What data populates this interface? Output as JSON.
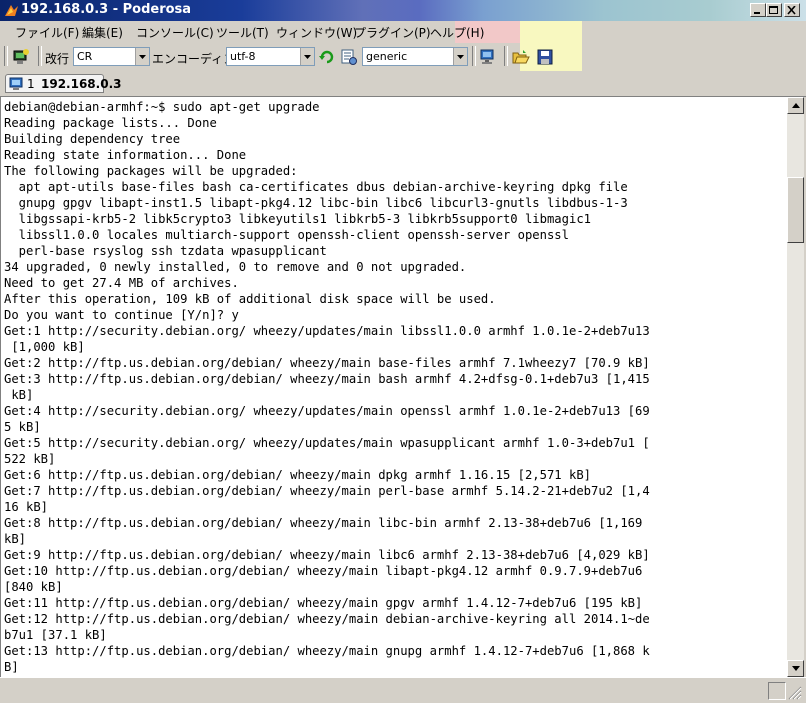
{
  "window": {
    "title": "192.168.0.3 - Poderosa",
    "colors": {
      "titlebar_start": "#0a246a",
      "chrome": "#d4d0c8"
    }
  },
  "menubar": {
    "items": [
      {
        "label": "ファイル(F)"
      },
      {
        "label": "編集(E)"
      },
      {
        "label": "コンソール(C)"
      },
      {
        "label": "ツール(T)"
      },
      {
        "label": "ウィンドウ(W)"
      },
      {
        "label": "プラグイン(P)"
      },
      {
        "label": "ヘルプ(H)"
      }
    ]
  },
  "toolbar": {
    "newline_label": "改行",
    "newline_value": "CR",
    "encoding_label": "エンコーディング",
    "encoding_value": "utf-8",
    "terminal_type_value": "generic",
    "icons": [
      "new-connection-icon",
      "reload-icon",
      "terminal-settings-icon",
      "network-icon",
      "open-folder-icon",
      "save-icon"
    ]
  },
  "tabs": [
    {
      "number": "1",
      "label": "192.168.0.3"
    }
  ],
  "terminal": {
    "lines": [
      "debian@debian-armhf:~$ sudo apt-get upgrade",
      "Reading package lists... Done",
      "Building dependency tree",
      "Reading state information... Done",
      "The following packages will be upgraded:",
      "  apt apt-utils base-files bash ca-certificates dbus debian-archive-keyring dpkg file",
      "  gnupg gpgv libapt-inst1.5 libapt-pkg4.12 libc-bin libc6 libcurl3-gnutls libdbus-1-3",
      "  libgssapi-krb5-2 libk5crypto3 libkeyutils1 libkrb5-3 libkrb5support0 libmagic1",
      "  libssl1.0.0 locales multiarch-support openssh-client openssh-server openssl",
      "  perl-base rsyslog ssh tzdata wpasupplicant",
      "34 upgraded, 0 newly installed, 0 to remove and 0 not upgraded.",
      "Need to get 27.4 MB of archives.",
      "After this operation, 109 kB of additional disk space will be used.",
      "Do you want to continue [Y/n]? y",
      "Get:1 http://security.debian.org/ wheezy/updates/main libssl1.0.0 armhf 1.0.1e-2+deb7u13",
      " [1,000 kB]",
      "Get:2 http://ftp.us.debian.org/debian/ wheezy/main base-files armhf 7.1wheezy7 [70.9 kB]",
      "Get:3 http://ftp.us.debian.org/debian/ wheezy/main bash armhf 4.2+dfsg-0.1+deb7u3 [1,415",
      " kB]",
      "Get:4 http://security.debian.org/ wheezy/updates/main openssl armhf 1.0.1e-2+deb7u13 [69",
      "5 kB]",
      "Get:5 http://security.debian.org/ wheezy/updates/main wpasupplicant armhf 1.0-3+deb7u1 [",
      "522 kB]",
      "Get:6 http://ftp.us.debian.org/debian/ wheezy/main dpkg armhf 1.16.15 [2,571 kB]",
      "Get:7 http://ftp.us.debian.org/debian/ wheezy/main perl-base armhf 5.14.2-21+deb7u2 [1,4",
      "16 kB]",
      "Get:8 http://ftp.us.debian.org/debian/ wheezy/main libc-bin armhf 2.13-38+deb7u6 [1,169",
      "kB]",
      "Get:9 http://ftp.us.debian.org/debian/ wheezy/main libc6 armhf 2.13-38+deb7u6 [4,029 kB]",
      "Get:10 http://ftp.us.debian.org/debian/ wheezy/main libapt-pkg4.12 armhf 0.9.7.9+deb7u6",
      "[840 kB]",
      "Get:11 http://ftp.us.debian.org/debian/ wheezy/main gpgv armhf 1.4.12-7+deb7u6 [195 kB]",
      "Get:12 http://ftp.us.debian.org/debian/ wheezy/main debian-archive-keyring all 2014.1~de",
      "b7u1 [37.1 kB]",
      "Get:13 http://ftp.us.debian.org/debian/ wheezy/main gnupg armhf 1.4.12-7+deb7u6 [1,868 k",
      "B]"
    ]
  }
}
